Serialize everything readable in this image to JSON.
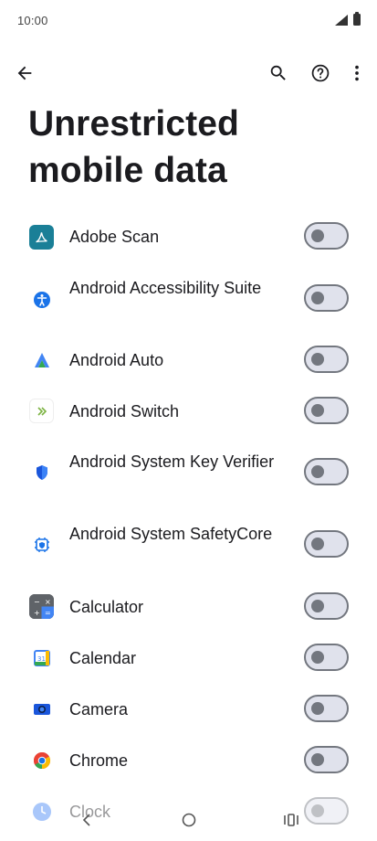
{
  "status_bar": {
    "time": "10:00"
  },
  "app_bar": {
    "back_icon": "arrow-back-icon",
    "search_icon": "search-icon",
    "help_icon": "help-circle-icon",
    "more_icon": "more-vert-icon"
  },
  "page": {
    "title": "Unrestricted mobile data"
  },
  "apps": [
    {
      "label": "Adobe Scan",
      "icon": "adobe-scan-icon",
      "enabled": false
    },
    {
      "label": "Android Accessibility Suite",
      "icon": "accessibility-icon",
      "enabled": false
    },
    {
      "label": "Android Auto",
      "icon": "android-auto-icon",
      "enabled": false
    },
    {
      "label": "Android Switch",
      "icon": "android-switch-icon",
      "enabled": false
    },
    {
      "label": "Android System Key Verifier",
      "icon": "key-verifier-icon",
      "enabled": false
    },
    {
      "label": "Android System SafetyCore",
      "icon": "safetycore-icon",
      "enabled": false
    },
    {
      "label": "Calculator",
      "icon": "calculator-icon",
      "enabled": false
    },
    {
      "label": "Calendar",
      "icon": "calendar-icon",
      "enabled": false
    },
    {
      "label": "Camera",
      "icon": "camera-icon",
      "enabled": false
    },
    {
      "label": "Chrome",
      "icon": "chrome-icon",
      "enabled": false
    },
    {
      "label": "Clock",
      "icon": "clock-icon",
      "enabled": false
    }
  ],
  "calendar_icon_text": "31",
  "colors": {
    "toggle_off_track": "#e0e2ec",
    "toggle_off_outline": "#73777f",
    "adobe_red": "#1a7f97",
    "accessibility_blue": "#1a73e8"
  },
  "nav_bar": {
    "back_icon": "nav-back-icon",
    "home_icon": "nav-home-icon",
    "recents_icon": "nav-recents-icon"
  }
}
